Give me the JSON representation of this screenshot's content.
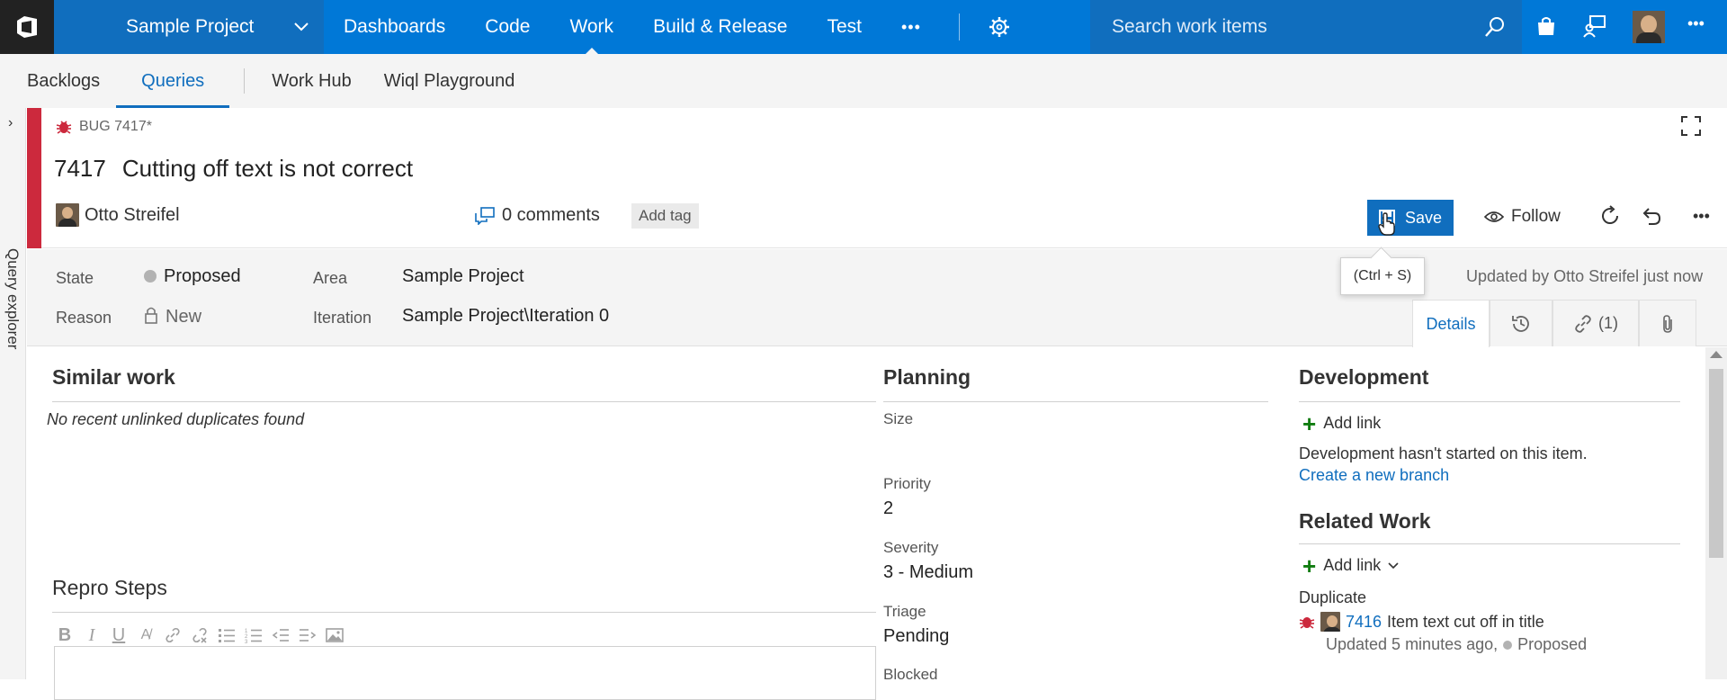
{
  "topnav": {
    "project": "Sample Project",
    "items": [
      {
        "label": "Dashboards"
      },
      {
        "label": "Code"
      },
      {
        "label": "Work",
        "active": true
      },
      {
        "label": "Build & Release"
      },
      {
        "label": "Test"
      }
    ],
    "more": "•••",
    "search_placeholder": "Search work items",
    "overflow": "•••"
  },
  "subnav": {
    "items": [
      {
        "label": "Backlogs"
      },
      {
        "label": "Queries",
        "active": true
      }
    ],
    "items_right": [
      {
        "label": "Work Hub"
      },
      {
        "label": "Wiql Playground"
      }
    ]
  },
  "rail": {
    "label": "Query explorer"
  },
  "work_item": {
    "type_label": "BUG 7417*",
    "id": "7417",
    "title": "Cutting off text is not correct",
    "assigned_to": "Otto Streifel",
    "comments": "0 comments",
    "add_tag": "Add tag",
    "save_label": "Save",
    "save_tooltip": "(Ctrl + S)",
    "follow_label": "Follow",
    "more": "•••"
  },
  "fields": {
    "state_label": "State",
    "state_value": "Proposed",
    "reason_label": "Reason",
    "reason_value": "New",
    "area_label": "Area",
    "area_value": "Sample Project",
    "iteration_label": "Iteration",
    "iteration_value": "Sample Project\\Iteration 0",
    "updated": "Updated by Otto Streifel just now"
  },
  "tabs": {
    "details": "Details",
    "links_count": "(1)"
  },
  "similar_work": {
    "title": "Similar work",
    "empty_note": "No recent unlinked duplicates found"
  },
  "repro": {
    "title": "Repro Steps"
  },
  "planning": {
    "title": "Planning",
    "size_label": "Size",
    "size_value": "",
    "priority_label": "Priority",
    "priority_value": "2",
    "severity_label": "Severity",
    "severity_value": "3 - Medium",
    "triage_label": "Triage",
    "triage_value": "Pending",
    "blocked_label": "Blocked"
  },
  "development": {
    "title": "Development",
    "add_link": "Add link",
    "status_text": "Development hasn't started on this item.",
    "create_branch": "Create a new branch"
  },
  "related_work": {
    "title": "Related Work",
    "add_link": "Add link",
    "group_label": "Duplicate",
    "item_id": "7416",
    "item_title": "Item text cut off in title",
    "item_updated": "Updated 5 minutes ago,",
    "item_state": "Proposed"
  },
  "colors": {
    "brand": "#0078d7",
    "bug_red": "#cc293d",
    "accent_blue": "#106ebe",
    "add_green": "#107c10"
  }
}
